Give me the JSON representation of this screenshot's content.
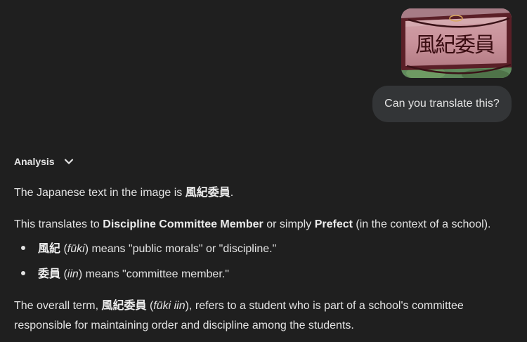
{
  "user_message": {
    "text": "Can you translate this?",
    "image": {
      "description_icon": "armband-photo",
      "armband_text": "風紀委員"
    }
  },
  "analysis": {
    "label": "Analysis"
  },
  "response": {
    "p1_prefix": "The Japanese text in the image is ",
    "p1_term": "風紀委員",
    "p1_suffix": ".",
    "p2_a": "This translates to ",
    "p2_b": "Discipline Committee Member",
    "p2_c": " or simply ",
    "p2_d": "Prefect",
    "p2_e": " (in the context of a school).",
    "bullet1_term": "風紀",
    "bullet1_open": " (",
    "bullet1_reading": "fūki",
    "bullet1_rest": ") means \"public morals\" or \"discipline.\"",
    "bullet2_term": "委員",
    "bullet2_open": " (",
    "bullet2_reading": "iin",
    "bullet2_rest": ") means \"committee member.\"",
    "p3_a": "The overall term, ",
    "p3_term": "風紀委員",
    "p3_open": " (",
    "p3_reading": "fūki iin",
    "p3_rest": "), refers to a student who is part of a school's committee",
    "p3_line2": "responsible for maintaining order and discipline among the students."
  },
  "colors": {
    "background": "#1f1f1f",
    "bubble": "#333537",
    "text": "#e3e3e3"
  }
}
